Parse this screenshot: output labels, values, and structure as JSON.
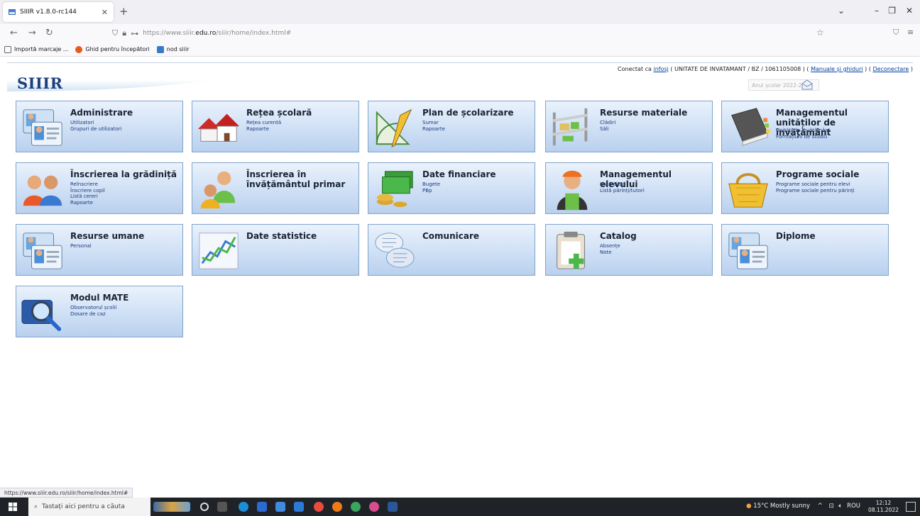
{
  "browser": {
    "tab_title": "SIIIR v1.8.0-rc144",
    "url_prefix": "https://www.siiir.",
    "url_domain": "edu.ro",
    "url_path": "/siiir/home/index.html#",
    "bookmarks": [
      "Importă marcaje ...",
      "Ghid pentru începători",
      "nod siiir"
    ],
    "status_url": "https://www.siiir.edu.ro/siiir/home/index.html#"
  },
  "header": {
    "logo": "SIIIR",
    "connected_as_prefix": "Conectat ca ",
    "user": "infosj",
    "unit_info": " ( UNITATE DE INVATAMANT / BZ / 1061105008 ) ( ",
    "manuals_link": "Manuale și ghiduri",
    "sep": " ) ( ",
    "logout_link": "Deconectare",
    "end": " )",
    "school_year": "Anul școlar 2022-2023"
  },
  "tiles": [
    {
      "title": "Administrare",
      "subs": [
        "Utilizatori",
        "Grupuri de utilizatori"
      ],
      "icon": "id-cards-icon"
    },
    {
      "title": "Rețea școlară",
      "subs": [
        "Rețea curentă",
        "Rapoarte"
      ],
      "icon": "houses-icon"
    },
    {
      "title": "Plan de școlarizare",
      "subs": [
        "Sumar",
        "Rapoarte"
      ],
      "icon": "drafting-icon"
    },
    {
      "title": "Resurse materiale",
      "subs": [
        "Clădiri",
        "Săli"
      ],
      "icon": "shelves-icon"
    },
    {
      "title": "Managementul unităților de învățământ",
      "subs": [
        "Unități de învățământ",
        "Formațiuni de studiu"
      ],
      "icon": "book-icon"
    },
    {
      "title": "Înscrierea la grădiniță",
      "subs": [
        "Reînscriere",
        "Înscriere copil",
        "Listă cereri",
        "Rapoarte"
      ],
      "icon": "people-icon"
    },
    {
      "title": "Înscrierea în învățământul primar",
      "subs": [],
      "icon": "children-icon"
    },
    {
      "title": "Date financiare",
      "subs": [
        "Bugete",
        "PBp"
      ],
      "icon": "money-icon"
    },
    {
      "title": "Managementul elevului",
      "subs": [
        "Listă elevi",
        "Listă părinți/tutori"
      ],
      "icon": "student-icon"
    },
    {
      "title": "Programe sociale",
      "subs": [
        "Programe sociale pentru elevi",
        "Programe sociale pentru părinți"
      ],
      "icon": "basket-icon"
    },
    {
      "title": "Resurse umane",
      "subs": [
        "Personal"
      ],
      "icon": "id-cards-icon"
    },
    {
      "title": "Date statistice",
      "subs": [],
      "icon": "chart-icon"
    },
    {
      "title": "Comunicare",
      "subs": [],
      "icon": "speech-bubbles-icon"
    },
    {
      "title": "Catalog",
      "subs": [
        "Absențe",
        "Note"
      ],
      "icon": "clipboard-icon"
    },
    {
      "title": "Diplome",
      "subs": [],
      "icon": "id-cards-icon"
    },
    {
      "title": "Modul MATE",
      "subs": [
        "Observatorul școlii",
        "Dosare de caz"
      ],
      "icon": "magnifier-icon"
    }
  ],
  "taskbar": {
    "search_placeholder": "Tastați aici pentru a căuta",
    "weather": "15°C  Mostly sunny",
    "lang": "ROU",
    "time": "12:12",
    "date": "08.11.2022"
  }
}
